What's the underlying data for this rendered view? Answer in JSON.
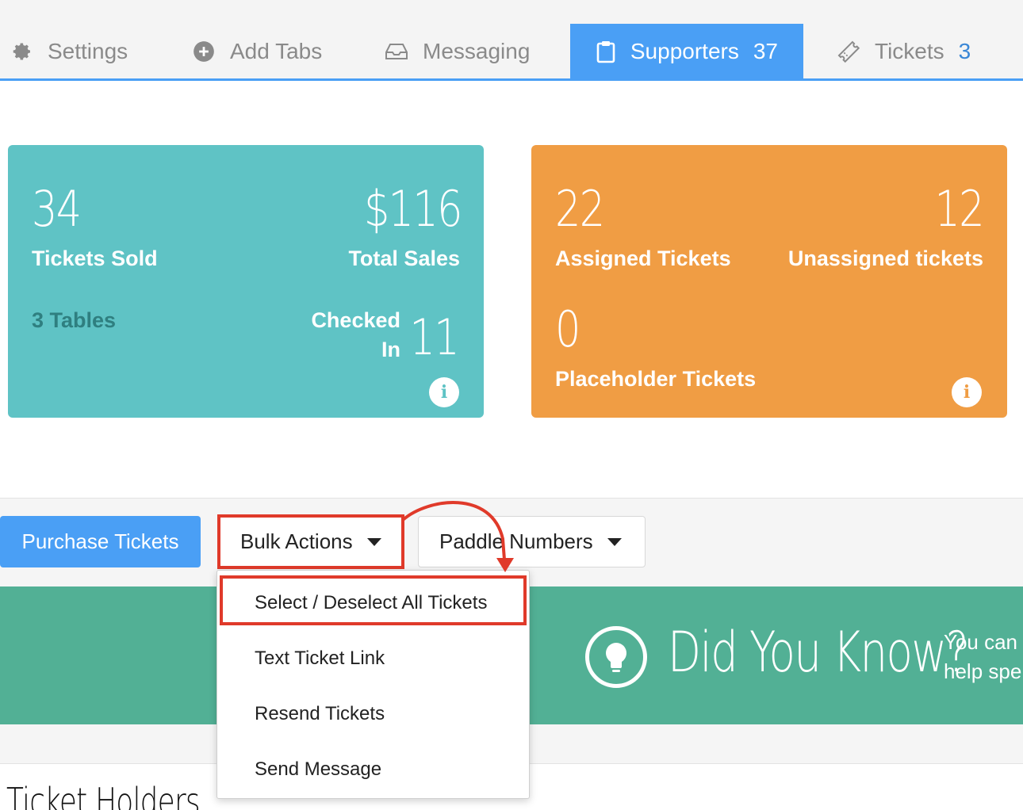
{
  "tabs": [
    {
      "label": "Settings",
      "icon": "gear-icon",
      "count": ""
    },
    {
      "label": "Add Tabs",
      "icon": "plus-circle-icon",
      "count": ""
    },
    {
      "label": "Messaging",
      "icon": "inbox-icon",
      "count": ""
    },
    {
      "label": "Supporters",
      "icon": "clipboard-icon",
      "count": "37",
      "active": true
    },
    {
      "label": "Tickets",
      "icon": "ticket-icon",
      "count": "3"
    }
  ],
  "cards": {
    "sales": {
      "tickets_sold_value": "34",
      "tickets_sold_label": "Tickets Sold",
      "total_sales_value": "$116",
      "total_sales_label": "Total Sales",
      "tables_label": "3 Tables",
      "checked_in_label_line1": "Checked",
      "checked_in_label_line2": "In",
      "checked_in_value": "11",
      "color": "#5fc3c5"
    },
    "assignment": {
      "assigned_value": "22",
      "assigned_label": "Assigned Tickets",
      "unassigned_value": "12",
      "unassigned_label": "Unassigned tickets",
      "placeholder_value": "0",
      "placeholder_label": "Placeholder Tickets",
      "color": "#f09d44"
    }
  },
  "toolbar": {
    "purchase_label": "Purchase Tickets",
    "bulk_label": "Bulk Actions",
    "paddle_label": "Paddle Numbers"
  },
  "bulk_menu": {
    "items": [
      "Select / Deselect All Tickets",
      "Text Ticket Link",
      "Resend Tickets",
      "Send Message"
    ]
  },
  "banner": {
    "title": "Did You Know?",
    "text_line1": "You can",
    "text_line2": "help spe"
  },
  "section": {
    "title": "Ticket Holders"
  },
  "accent_color": "#4a9ff5",
  "highlight_color": "#e03a2a"
}
